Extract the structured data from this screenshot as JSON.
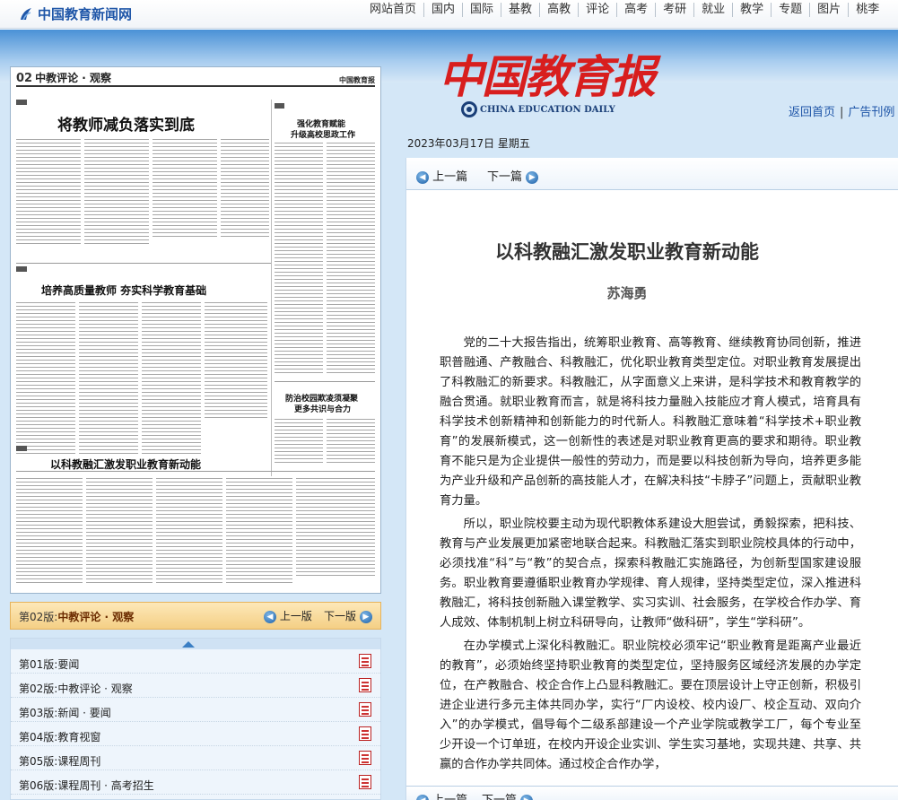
{
  "site": {
    "name": "中国教育新闻网",
    "nav": [
      "网站首页",
      "国内",
      "国际",
      "基教",
      "高教",
      "评论",
      "高考",
      "考研",
      "就业",
      "教学",
      "专题",
      "图片",
      "桃李"
    ]
  },
  "masthead": {
    "title": "中国教育报",
    "english": "CHINA EDUCATION DAILY",
    "links": [
      "返回首页",
      "广告刊例"
    ]
  },
  "date": "2023年03月17日  星期五",
  "paper_preview": {
    "page_num": "02",
    "section": "中教评论 · 观察",
    "brand": "中国教育报",
    "headlines": [
      "将教师减负落实到底",
      "强化教育赋能",
      "升级高校思政工作",
      "培养高质量教师  夯实科学教育基础",
      "防治校园欺凌须凝聚",
      "更多共识与合力",
      "以科教融汇激发职业教育新动能"
    ]
  },
  "page_nav": {
    "current_prefix": "第02版:",
    "current_name": "中教评论 · 观察",
    "prev": "上一版",
    "next": "下一版"
  },
  "page_list": [
    {
      "num": "第01版:",
      "name": "要闻"
    },
    {
      "num": "第02版:",
      "name": "中教评论 · 观察"
    },
    {
      "num": "第03版:",
      "name": "新闻 · 要闻"
    },
    {
      "num": "第04版:",
      "name": "教育视窗"
    },
    {
      "num": "第05版:",
      "name": "课程周刊"
    },
    {
      "num": "第06版:",
      "name": "课程周刊 · 高考招生"
    }
  ],
  "article_nav": {
    "prev": "上一篇",
    "next": "下一篇"
  },
  "article": {
    "title": "以科教融汇激发职业教育新动能",
    "author": "苏海勇",
    "paragraphs": [
      "党的二十大报告指出，统筹职业教育、高等教育、继续教育协同创新，推进职普融通、产教融合、科教融汇，优化职业教育类型定位。对职业教育发展提出了科教融汇的新要求。科教融汇，从字面意义上来讲，是科学技术和教育教学的融合贯通。就职业教育而言，就是将科技力量融入技能应才育人模式，培育具有科学技术创新精神和创新能力的时代新人。科教融汇意味着“科学技术+职业教育”的发展新模式，这一创新性的表述是对职业教育更高的要求和期待。职业教育不能只是为企业提供一般性的劳动力，而是要以科技创新为导向，培养更多能为产业升级和产品创新的高技能人才，在解决科技“卡脖子”问题上，贡献职业教育力量。",
      "所以，职业院校要主动为现代职教体系建设大胆尝试，勇毅探索，把科技、教育与产业发展更加紧密地联合起来。科教融汇落实到职业院校具体的行动中，必须找准“科”与“教”的契合点，探索科教融汇实施路径，为创新型国家建设服务。职业教育要遵循职业教育办学规律、育人规律，坚持类型定位，深入推进科教融汇，将科技创新融入课堂教学、实习实训、社会服务，在学校合作办学、育人成效、体制机制上树立科研导向，让教师“做科研”，学生“学科研”。",
      "在办学模式上深化科教融汇。职业院校必须牢记“职业教育是距离产业最近的教育”，必须始终坚持职业教育的类型定位，坚持服务区域经济发展的办学定位，在产教融合、校企合作上凸显科教融汇。要在顶层设计上守正创新，积极引进企业进行多元主体共同办学，实行“厂内设校、校内设厂、校企互动、双向介入”的办学模式，倡导每个二级系部建设一个产业学院或教学工厂，每个专业至少开设一个订单班，在校内开设企业实训、学生实习基地，实现共建、共享、共赢的合作办学共同体。通过校企合作办学，"
    ]
  }
}
